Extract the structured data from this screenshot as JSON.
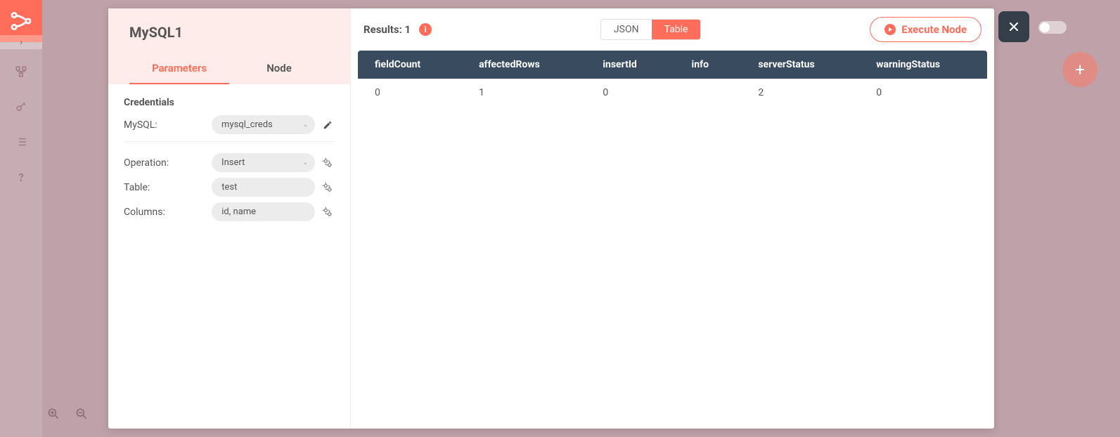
{
  "sidebar": {
    "icons": [
      "workflow-icon",
      "key-icon",
      "list-icon",
      "help-icon"
    ]
  },
  "node": {
    "title": "MySQL1",
    "tabs": {
      "parameters": "Parameters",
      "node": "Node"
    },
    "credentials_section": "Credentials",
    "cred_label": "MySQL:",
    "cred_value": "mysql_creds",
    "params": {
      "operation_label": "Operation:",
      "operation_value": "Insert",
      "table_label": "Table:",
      "table_value": "test",
      "columns_label": "Columns:",
      "columns_value": "id, name"
    }
  },
  "results": {
    "label": "Results:",
    "count": "1",
    "view_json": "JSON",
    "view_table": "Table",
    "execute": "Execute Node",
    "columns": [
      "fieldCount",
      "affectedRows",
      "insertId",
      "info",
      "serverStatus",
      "warningStatus"
    ],
    "rows": [
      {
        "fieldCount": "0",
        "affectedRows": "1",
        "insertId": "0",
        "info": "",
        "serverStatus": "2",
        "warningStatus": "0"
      }
    ]
  }
}
